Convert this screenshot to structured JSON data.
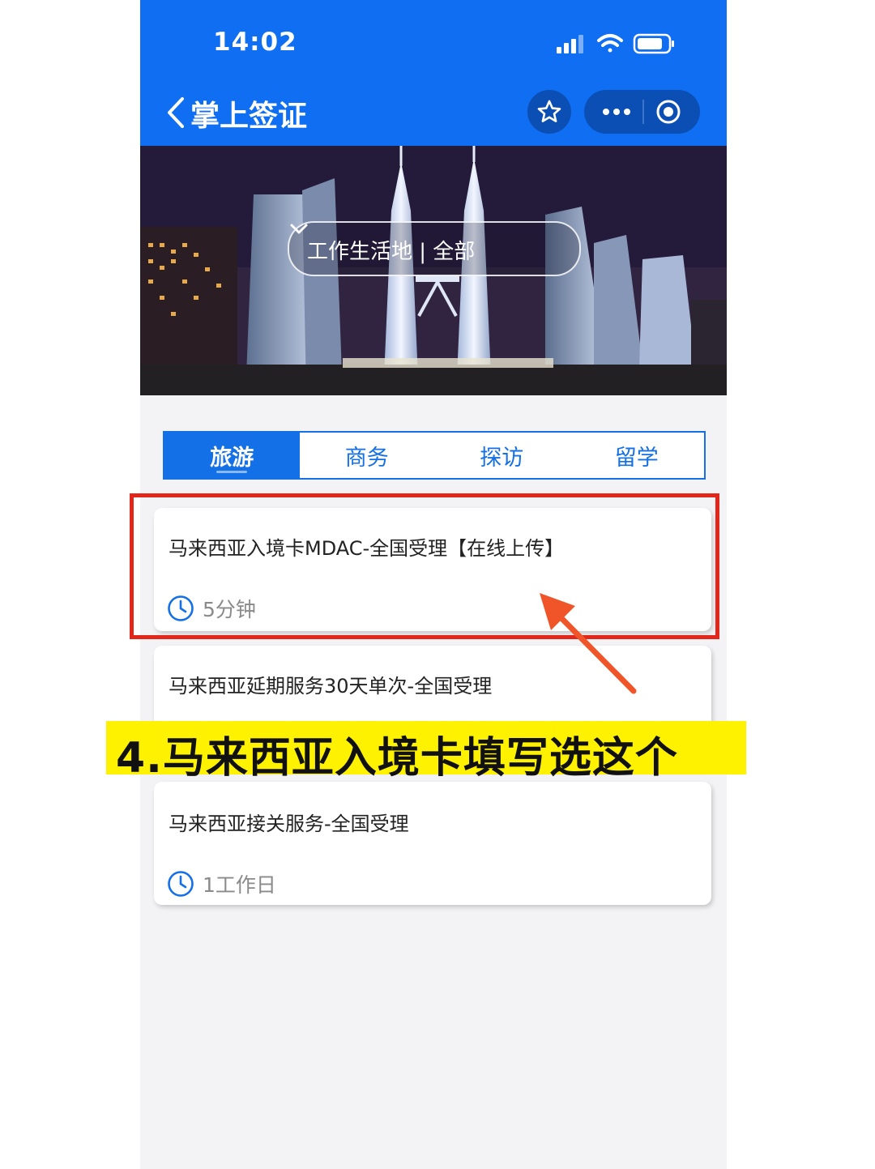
{
  "status_bar": {
    "time": "14:02"
  },
  "nav": {
    "title": "掌上签证"
  },
  "banner": {
    "location_label": "工作生活地 | 全部"
  },
  "tabs": [
    {
      "label": "旅游",
      "active": true
    },
    {
      "label": "商务",
      "active": false
    },
    {
      "label": "探访",
      "active": false
    },
    {
      "label": "留学",
      "active": false
    }
  ],
  "services": [
    {
      "title": "马来西亚入境卡MDAC-全国受理【在线上传】",
      "duration": "5分钟"
    },
    {
      "title": "马来西亚延期服务30天单次-全国受理",
      "duration": ""
    },
    {
      "title": "马来西亚接关服务-全国受理",
      "duration": "1工作日"
    }
  ],
  "annotation": {
    "caption": "4.马来西亚入境卡填写选这个",
    "highlight_color": "#e2261a",
    "caption_background": "#fef200",
    "arrow_color": "#f0552a"
  },
  "colors": {
    "header": "#0f6ef2",
    "accent": "#1470e6"
  },
  "icons": [
    "back-chevron-icon",
    "star-icon",
    "more-dots-icon",
    "target-icon",
    "chevron-down-icon",
    "clock-icon",
    "signal-icon",
    "wifi-icon",
    "battery-icon"
  ]
}
